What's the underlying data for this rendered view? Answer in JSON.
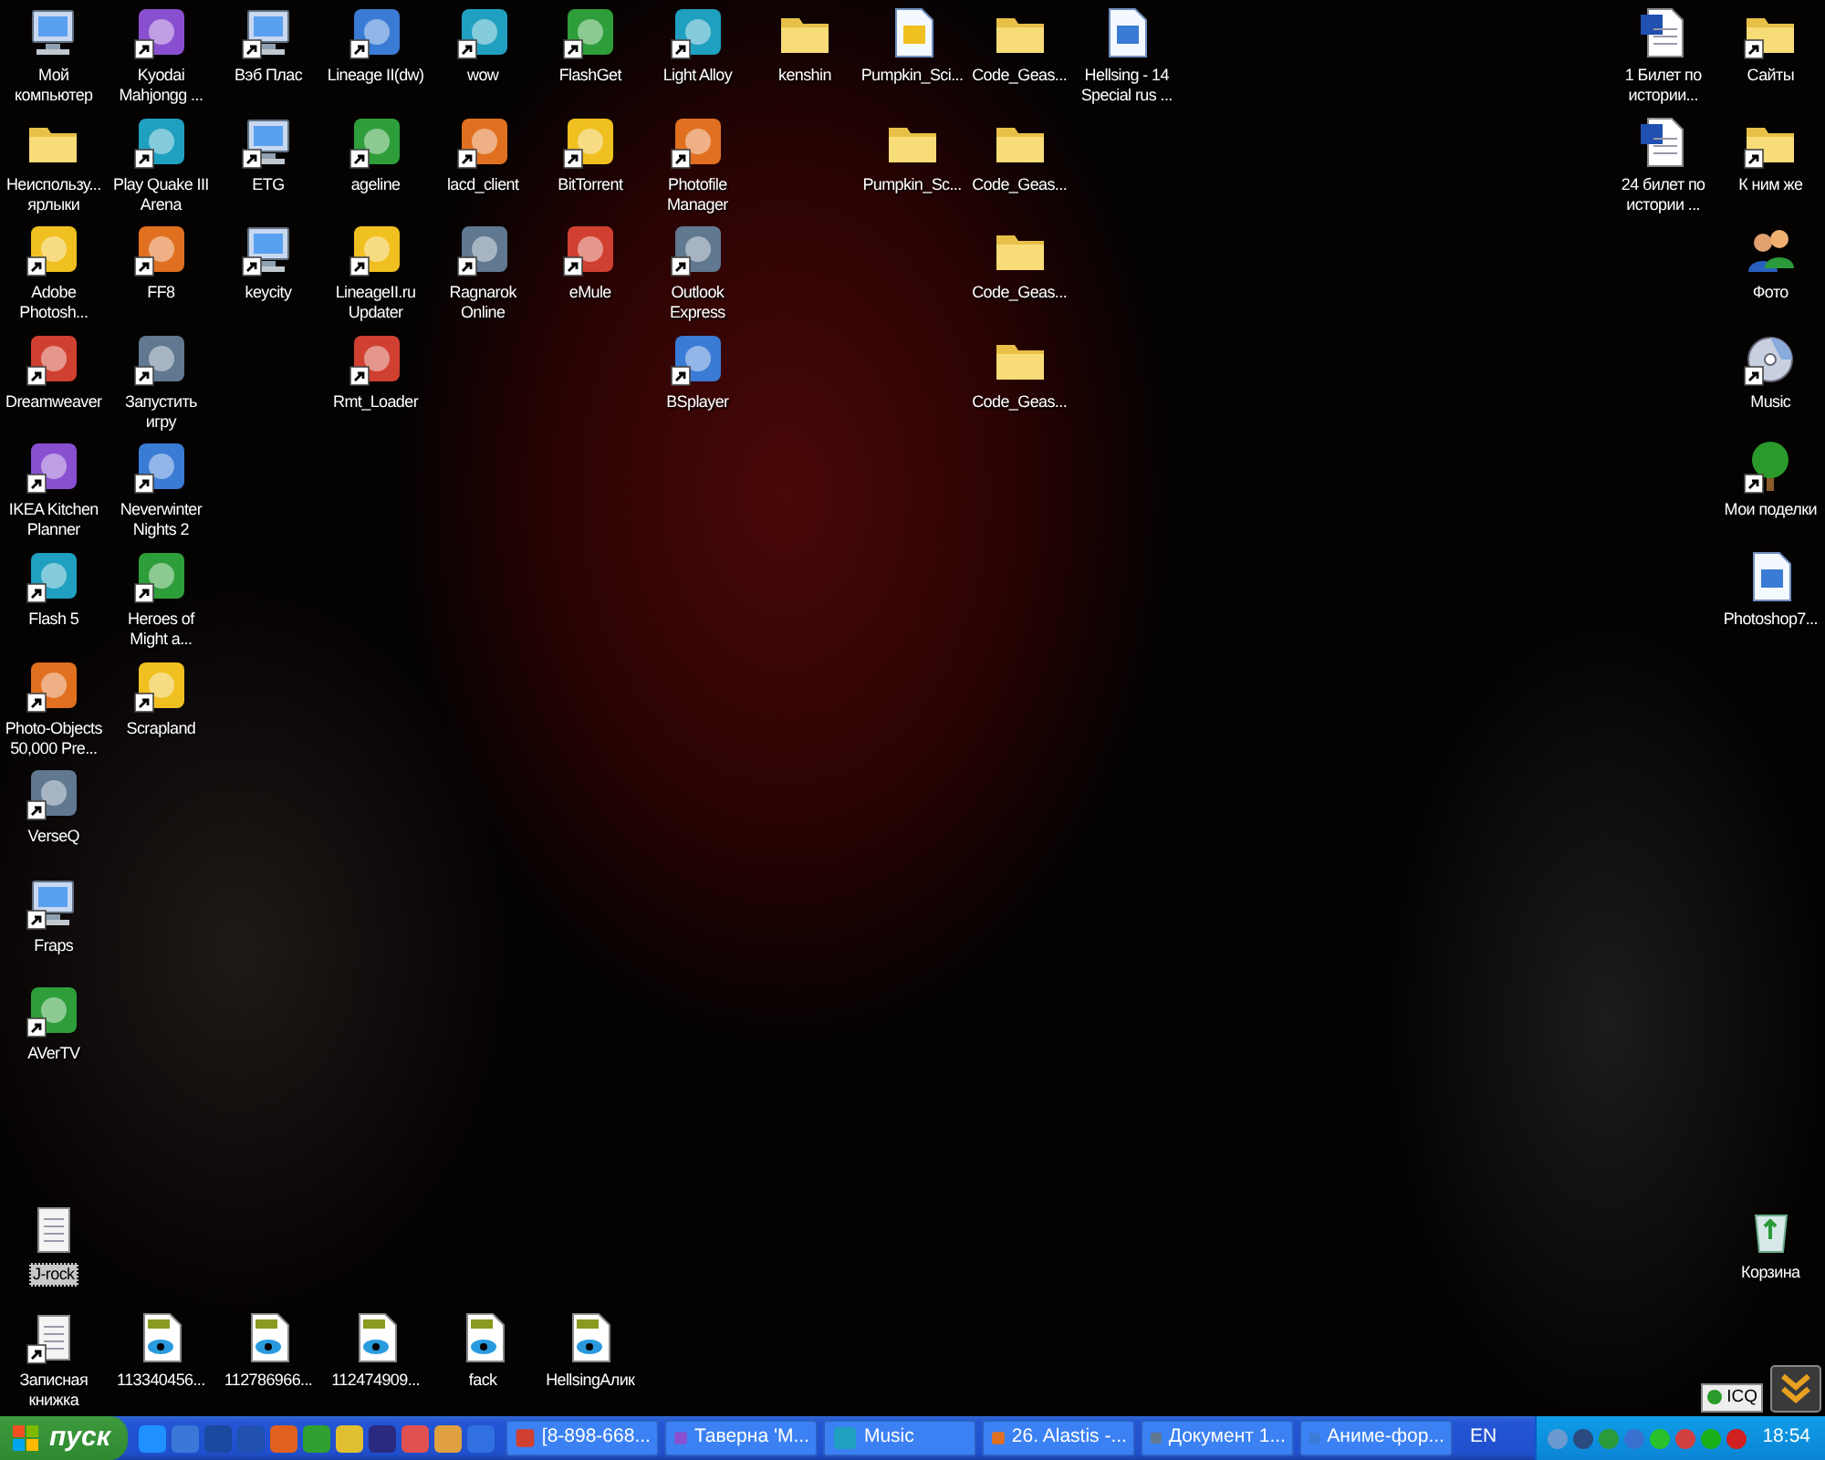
{
  "desktop": {
    "icons": [
      {
        "label": "Мой компьютер",
        "kind": "computer",
        "shortcut": false,
        "selected": false
      },
      {
        "label": "Неиспользу... ярлыки",
        "kind": "folder",
        "shortcut": false,
        "selected": false
      },
      {
        "label": "Adobe Photosh...",
        "kind": "app",
        "shortcut": true,
        "selected": false
      },
      {
        "label": "Dreamweaver",
        "kind": "app",
        "shortcut": true,
        "selected": false
      },
      {
        "label": "IKEA Kitchen Planner",
        "kind": "app",
        "shortcut": true,
        "selected": false
      },
      {
        "label": "Flash 5",
        "kind": "app",
        "shortcut": true,
        "selected": false
      },
      {
        "label": "Photo-Objects 50,000 Pre...",
        "kind": "app",
        "shortcut": true,
        "selected": false
      },
      {
        "label": "VerseQ",
        "kind": "app",
        "shortcut": true,
        "selected": false
      },
      {
        "label": "Fraps",
        "kind": "computer",
        "shortcut": true,
        "selected": false
      },
      {
        "label": "AVerTV",
        "kind": "app",
        "shortcut": true,
        "selected": false
      },
      {
        "label": "J-rock",
        "kind": "notepad",
        "shortcut": false,
        "selected": true
      },
      {
        "label": "Записная книжка",
        "kind": "notepad",
        "shortcut": true,
        "selected": false
      },
      {
        "label": "Kyodai Mahjongg ...",
        "kind": "app",
        "shortcut": true,
        "selected": false
      },
      {
        "label": "Play Quake III Arena",
        "kind": "app",
        "shortcut": true,
        "selected": false
      },
      {
        "label": "FF8",
        "kind": "app",
        "shortcut": true,
        "selected": false
      },
      {
        "label": "Запустить игру",
        "kind": "app",
        "shortcut": true,
        "selected": false
      },
      {
        "label": "Neverwinter Nights 2",
        "kind": "app",
        "shortcut": true,
        "selected": false
      },
      {
        "label": "Heroes of Might a...",
        "kind": "app",
        "shortcut": true,
        "selected": false
      },
      {
        "label": "Scrapland",
        "kind": "app",
        "shortcut": true,
        "selected": false
      },
      {
        "label": "113340456...",
        "kind": "image",
        "shortcut": false,
        "selected": false
      },
      {
        "label": "Вэб Плас",
        "kind": "computer",
        "shortcut": true,
        "selected": false
      },
      {
        "label": "ETG",
        "kind": "computer",
        "shortcut": true,
        "selected": false
      },
      {
        "label": "keycity",
        "kind": "computer",
        "shortcut": true,
        "selected": false
      },
      {
        "label": "112786966...",
        "kind": "image",
        "shortcut": false,
        "selected": false
      },
      {
        "label": "Lineage II(dw)",
        "kind": "app",
        "shortcut": true,
        "selected": false
      },
      {
        "label": "ageline",
        "kind": "app",
        "shortcut": true,
        "selected": false
      },
      {
        "label": "LineageII.ru Updater",
        "kind": "app",
        "shortcut": true,
        "selected": false
      },
      {
        "label": "Rmt_Loader",
        "kind": "app",
        "shortcut": true,
        "selected": false
      },
      {
        "label": "112474909...",
        "kind": "image",
        "shortcut": false,
        "selected": false
      },
      {
        "label": "wow",
        "kind": "app",
        "shortcut": true,
        "selected": false
      },
      {
        "label": "lacd_client",
        "kind": "app",
        "shortcut": true,
        "selected": false
      },
      {
        "label": "Ragnarok Online",
        "kind": "app",
        "shortcut": true,
        "selected": false
      },
      {
        "label": "fack",
        "kind": "image",
        "shortcut": false,
        "selected": false
      },
      {
        "label": "FlashGet",
        "kind": "app",
        "shortcut": true,
        "selected": false
      },
      {
        "label": "BitTorrent",
        "kind": "app",
        "shortcut": true,
        "selected": false
      },
      {
        "label": "eMule",
        "kind": "app",
        "shortcut": true,
        "selected": false
      },
      {
        "label": "HellsingАлик",
        "kind": "image",
        "shortcut": false,
        "selected": false
      },
      {
        "label": "Light Alloy",
        "kind": "app",
        "shortcut": true,
        "selected": false
      },
      {
        "label": "Photofile Manager",
        "kind": "app",
        "shortcut": true,
        "selected": false
      },
      {
        "label": "Outlook Express",
        "kind": "app",
        "shortcut": true,
        "selected": false
      },
      {
        "label": "BSplayer",
        "kind": "app",
        "shortcut": true,
        "selected": false
      },
      {
        "label": "kenshin",
        "kind": "folder",
        "shortcut": false,
        "selected": false
      },
      {
        "label": "Pumpkin_Sci...",
        "kind": "document",
        "shortcut": false,
        "selected": false
      },
      {
        "label": "Pumpkin_Sc...",
        "kind": "folder",
        "shortcut": false,
        "selected": false
      },
      {
        "label": "Code_Geas...",
        "kind": "folder",
        "shortcut": false,
        "selected": false
      },
      {
        "label": "Code_Geas...",
        "kind": "folder",
        "shortcut": false,
        "selected": false
      },
      {
        "label": "Code_Geas...",
        "kind": "folder",
        "shortcut": false,
        "selected": false
      },
      {
        "label": "Code_Geas...",
        "kind": "folder",
        "shortcut": false,
        "selected": false
      },
      {
        "label": "Hellsing - 14 Special rus ...",
        "kind": "document",
        "shortcut": false,
        "selected": false
      },
      {
        "label": "1 Билет по истории...",
        "kind": "word",
        "shortcut": false,
        "selected": false
      },
      {
        "label": "24 билет по истории ...",
        "kind": "word",
        "shortcut": false,
        "selected": false
      },
      {
        "label": "Сайты",
        "kind": "folder",
        "shortcut": true,
        "selected": false
      },
      {
        "label": "К ним же",
        "kind": "folder",
        "shortcut": true,
        "selected": false
      },
      {
        "label": "Фото",
        "kind": "people",
        "shortcut": false,
        "selected": false
      },
      {
        "label": "Music",
        "kind": "disc",
        "shortcut": true,
        "selected": false
      },
      {
        "label": "Мои поделки",
        "kind": "tree",
        "shortcut": true,
        "selected": false
      },
      {
        "label": "Photoshop7...",
        "kind": "document",
        "shortcut": false,
        "selected": false
      },
      {
        "label": "Корзина",
        "kind": "recycle",
        "shortcut": false,
        "selected": false
      }
    ]
  },
  "icq": {
    "label": "ICQ"
  },
  "taskbar": {
    "start_button": "пуск",
    "tasks": [
      {
        "label": "[8-898-668...",
        "selected": false
      },
      {
        "label": "Таверна 'М...",
        "selected": false
      },
      {
        "label": "Music",
        "selected": false
      },
      {
        "label": "26. Alastis -...",
        "selected": false
      },
      {
        "label": "Документ 1...",
        "selected": false
      },
      {
        "label": "Аниме-фор...",
        "selected": false
      }
    ],
    "language": "EN",
    "clock": "18:54"
  }
}
